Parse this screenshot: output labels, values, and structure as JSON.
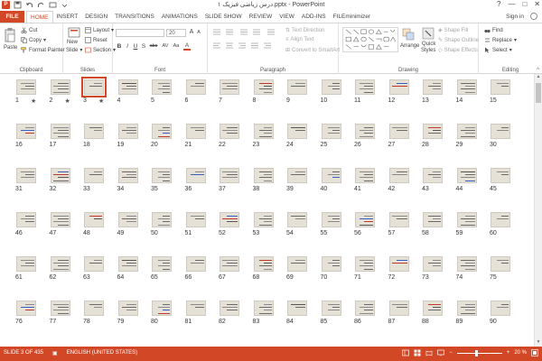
{
  "window": {
    "title": "درس زیاضی فیزیک ۱.pptx - PowerPoint",
    "minimize_glyph": "—",
    "maximize_glyph": "□",
    "close_glyph": "✕",
    "help_glyph": "?"
  },
  "tabs": {
    "file": "FILE",
    "items": [
      "HOME",
      "INSERT",
      "DESIGN",
      "TRANSITIONS",
      "ANIMATIONS",
      "SLIDE SHOW",
      "REVIEW",
      "VIEW",
      "ADD-INS",
      "FILEminimizer"
    ],
    "active": "HOME",
    "sign_in": "Sign in"
  },
  "ribbon": {
    "clipboard": {
      "label": "Clipboard",
      "paste": "Paste",
      "cut": "Cut",
      "copy": "Copy",
      "format_painter": "Format Painter"
    },
    "slides": {
      "label": "Slides",
      "new_slide": "New",
      "new_slide_2": "Slide",
      "layout": "Layout",
      "reset": "Reset",
      "section": "Section"
    },
    "font": {
      "label": "Font",
      "size": "20",
      "bold": "B",
      "italic": "I",
      "underline": "U",
      "shadow": "S",
      "strike": "abc",
      "spacing": "AV",
      "case": "Aa",
      "color": "A",
      "grow": "A",
      "shrink": "A",
      "clear": "A"
    },
    "paragraph": {
      "label": "Paragraph",
      "text_direction": "Text Direction",
      "align_text": "Align Text",
      "convert_smartart": "Convert to SmartArt"
    },
    "drawing": {
      "label": "Drawing",
      "arrange": "Arrange",
      "quick_styles": "Quick",
      "quick_styles_2": "Styles",
      "shape_fill": "Shape Fill",
      "shape_outline": "Shape Outline",
      "shape_effects": "Shape Effects"
    },
    "editing": {
      "label": "Editing",
      "find": "Find",
      "replace": "Replace",
      "select": "Select"
    }
  },
  "sorter": {
    "selected_slide": 3,
    "star_marker": "★",
    "rows": [
      [
        1,
        2,
        3,
        4,
        5,
        6,
        7,
        8,
        9,
        10,
        11,
        12,
        13,
        14,
        15
      ],
      [
        16,
        17,
        18,
        19,
        20,
        21,
        22,
        23,
        24,
        25,
        26,
        27,
        28,
        29,
        30
      ],
      [
        31,
        32,
        33,
        34,
        35,
        36,
        37,
        38,
        39,
        40,
        41,
        42,
        43,
        44,
        45
      ],
      [
        46,
        47,
        48,
        49,
        50,
        51,
        52,
        53,
        54,
        55,
        56,
        57,
        58,
        59,
        60
      ],
      [
        61,
        62,
        63,
        64,
        65,
        66,
        67,
        68,
        69,
        70,
        71,
        72,
        73,
        74,
        75
      ],
      [
        76,
        77,
        78,
        79,
        80,
        81,
        82,
        83,
        84,
        85,
        86,
        87,
        88,
        89,
        90
      ]
    ],
    "starred": [
      1,
      2,
      3
    ]
  },
  "statusbar": {
    "slide_info": "SLIDE 3 OF 435",
    "language": "ENGLISH (UNITED STATES)",
    "zoom": "20 %",
    "zoom_minus": "−",
    "zoom_plus": "+"
  },
  "colors": {
    "accent": "#d24726",
    "slide_bg": "#e6e1d6"
  }
}
